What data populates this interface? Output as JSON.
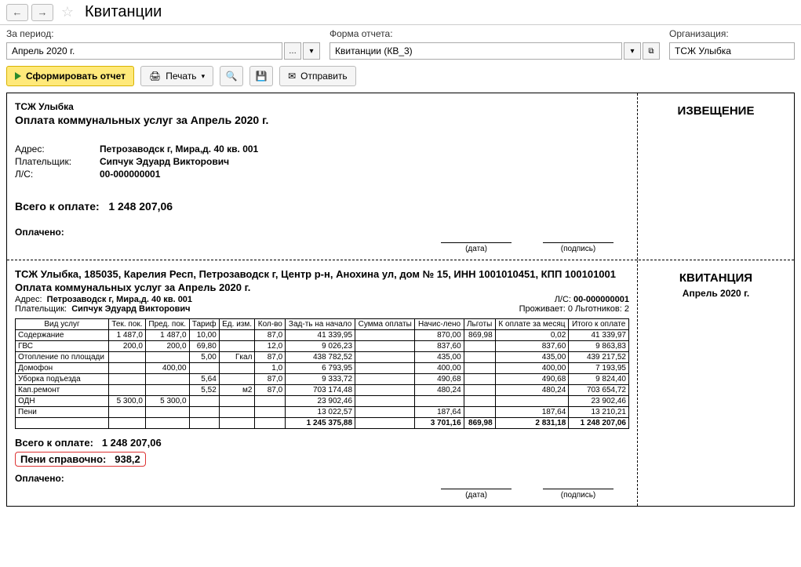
{
  "header": {
    "title": "Квитанции"
  },
  "filters": {
    "period_label": "За период:",
    "period_value": "Апрель 2020 г.",
    "form_label": "Форма отчета:",
    "form_value": "Квитанции (КВ_3)",
    "org_label": "Организация:",
    "org_value": "ТСЖ Улыбка"
  },
  "toolbar": {
    "generate": "Сформировать отчет",
    "print": "Печать",
    "send": "Отправить"
  },
  "notice": {
    "title_right": "ИЗВЕЩЕНИЕ",
    "org": "ТСЖ Улыбка",
    "heading": "Оплата коммунальных услуг за Апрель 2020 г.",
    "addr_label": "Адрес:",
    "addr": "Петрозаводск г, Мира,д. 40 кв. 001",
    "payer_label": "Плательщик:",
    "payer": "Сипчук Эдуард Викторович",
    "ls_label": "Л/С:",
    "ls": "00-000000001",
    "total_label": "Всего к оплате:",
    "total": "1 248 207,06",
    "paid_label": "Оплачено:",
    "date_caption": "(дата)",
    "sign_caption": "(подпись)"
  },
  "receipt": {
    "title_right": "КВИТАНЦИЯ",
    "period_right": "Апрель 2020 г.",
    "org_full": "ТСЖ Улыбка, 185035, Карелия Респ, Петрозаводск г, Центр р-н, Анохина ул, дом № 15, ИНН 1001010451, КПП 100101001",
    "heading": "Оплата коммунальных услуг за Апрель 2020 г.",
    "addr_label": "Адрес:",
    "addr": "Петрозаводск г, Мира,д. 40 кв. 001",
    "payer_label": "Плательщик:",
    "payer": "Сипчук Эдуард Викторович",
    "ls_label": "Л/С:",
    "ls": "00-000000001",
    "residents": "Проживает: 0 Льготников: 2",
    "columns": [
      "Вид услуг",
      "Тек. пок.",
      "Пред. пок.",
      "Тариф",
      "Ед. изм.",
      "Кол-во",
      "Зад-ть на начало",
      "Сумма оплаты",
      "Начис-лено",
      "Льготы",
      "К оплате за месяц",
      "Итого к оплате"
    ],
    "rows": [
      {
        "name": "Содержание",
        "c": [
          "1 487,0",
          "1 487,0",
          "10,00",
          "",
          "87,0",
          "41 339,95",
          "",
          "870,00",
          "869,98",
          "0,02",
          "41 339,97"
        ]
      },
      {
        "name": "ГВС",
        "c": [
          "200,0",
          "200,0",
          "69,80",
          "",
          "12,0",
          "9 026,23",
          "",
          "837,60",
          "",
          "837,60",
          "9 863,83"
        ]
      },
      {
        "name": "Отопление по площади",
        "c": [
          "",
          "",
          "5,00",
          "Гкал",
          "87,0",
          "438 782,52",
          "",
          "435,00",
          "",
          "435,00",
          "439 217,52"
        ]
      },
      {
        "name": "Домофон",
        "c": [
          "",
          "400,00",
          "",
          "",
          "1,0",
          "6 793,95",
          "",
          "400,00",
          "",
          "400,00",
          "7 193,95"
        ]
      },
      {
        "name": "Уборка подъезда",
        "c": [
          "",
          "",
          "5,64",
          "",
          "87,0",
          "9 333,72",
          "",
          "490,68",
          "",
          "490,68",
          "9 824,40"
        ]
      },
      {
        "name": "Кап.ремонт",
        "c": [
          "",
          "",
          "5,52",
          "м2",
          "87,0",
          "703 174,48",
          "",
          "480,24",
          "",
          "480,24",
          "703 654,72"
        ]
      },
      {
        "name": "ОДН",
        "c": [
          "5 300,0",
          "5 300,0",
          "",
          "",
          "",
          "23 902,46",
          "",
          "",
          "",
          "",
          "23 902,46"
        ]
      },
      {
        "name": "Пени",
        "c": [
          "",
          "",
          "",
          "",
          "",
          "13 022,57",
          "",
          "187,64",
          "",
          "187,64",
          "13 210,21"
        ]
      }
    ],
    "total_row": [
      "",
      "",
      "",
      "",
      "",
      "1 245 375,88",
      "",
      "3 701,16",
      "869,98",
      "2 831,18",
      "1 248 207,06"
    ],
    "total_label": "Всего к оплате:",
    "total": "1 248 207,06",
    "peni_label": "Пени справочно:",
    "peni": "938,2",
    "paid_label": "Оплачено:",
    "date_caption": "(дата)",
    "sign_caption": "(подпись)"
  }
}
